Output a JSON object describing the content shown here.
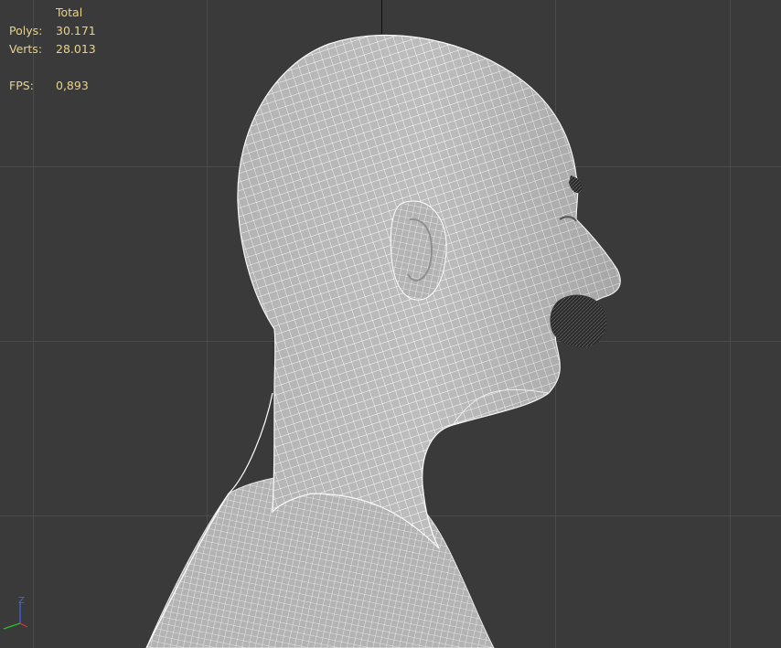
{
  "viewport": {
    "stats": {
      "total_label": "Total",
      "polys_label": "Polys:",
      "polys_value": "30.171",
      "verts_label": "Verts:",
      "verts_value": "28.013",
      "fps_label": "FPS:",
      "fps_value": "0,893"
    },
    "axis_label": "Z",
    "colors": {
      "background": "#3a3a3a",
      "grid": "#4b4b4b",
      "stats_text": "#e9d28a",
      "mesh_fill": "#b9b9b9",
      "wireframe": "#ffffff",
      "beard": "#2a2a2a"
    }
  }
}
